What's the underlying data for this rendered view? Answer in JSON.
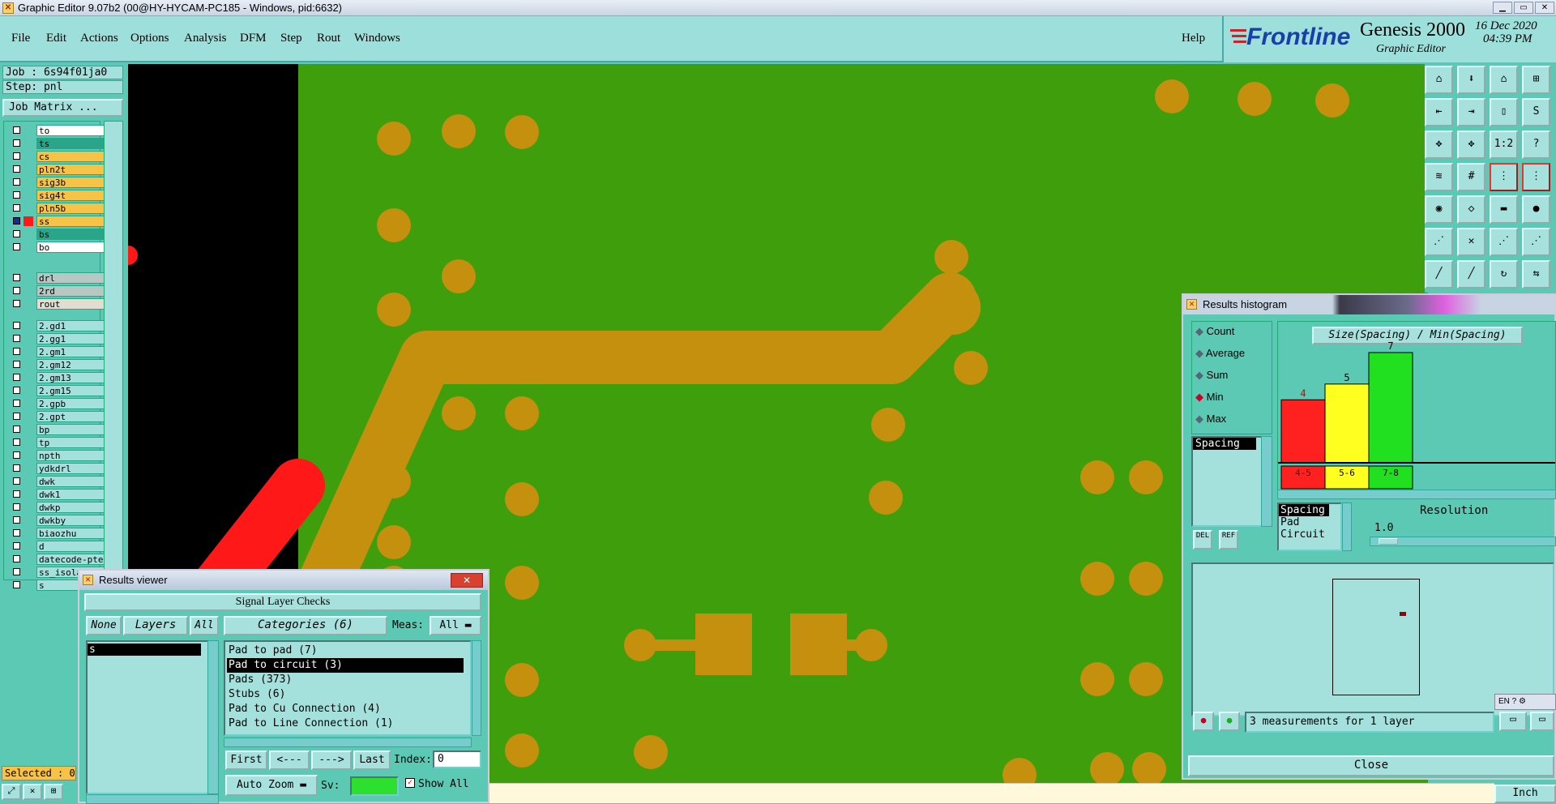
{
  "titlebar": {
    "text": "Graphic Editor 9.07b2 (00@HY-HYCAM-PC185 - Windows, pid:6632)"
  },
  "menu": [
    "File",
    "Edit",
    "Actions",
    "Options",
    "Analysis",
    "DFM",
    "Step",
    "Rout",
    "Windows"
  ],
  "help": "Help",
  "brand": {
    "logo": "Frontline",
    "product": "Genesis 2000",
    "subtitle": "Graphic Editor",
    "date": "16 Dec 2020",
    "time": "04:39 PM"
  },
  "left": {
    "job": "Job : 6s94f01ja0",
    "step": "Step: pnl",
    "job_matrix": "Job Matrix ...",
    "selected": "Selected : 0"
  },
  "layers": {
    "group1": [
      {
        "name": "to",
        "color": "#ffffff"
      },
      {
        "name": "ts",
        "color": "#2aa58a"
      },
      {
        "name": "cs",
        "color": "#f6c346"
      },
      {
        "name": "pln2t",
        "color": "#f6c346"
      },
      {
        "name": "sig3b",
        "color": "#f6c346"
      },
      {
        "name": "sig4t",
        "color": "#f6c346"
      },
      {
        "name": "pln5b",
        "color": "#f6c346"
      },
      {
        "name": "ss",
        "color": "#f6c346"
      },
      {
        "name": "bs",
        "color": "#2aa58a"
      },
      {
        "name": "bo",
        "color": "#ffffff"
      }
    ],
    "group2": [
      {
        "name": "drl",
        "color": "#b7c8c4"
      },
      {
        "name": "2rd",
        "color": "#b7c8c4"
      },
      {
        "name": "rout",
        "color": "#e2ddd0"
      }
    ],
    "group3": [
      "2.gd1",
      "2.gg1",
      "2.gm1",
      "2.gm12",
      "2.gm13",
      "2.gm15",
      "2.gpb",
      "2.gpt",
      "bp",
      "tp",
      "npth",
      "ydkdrl",
      "dwk",
      "dwk1",
      "dwkp",
      "dwkby",
      "biaozhu",
      "d",
      "datecode-pte",
      "ss_isolated",
      "s"
    ]
  },
  "results_viewer": {
    "title": "Results viewer",
    "header": "Signal Layer Checks",
    "none": "None",
    "layers": "Layers",
    "all": "All",
    "categories": "Categories (6)",
    "meas_label": "Meas:",
    "meas_value": "All",
    "layer_list": [
      "s"
    ],
    "category_list": [
      "Pad to pad (7)",
      "Pad to circuit (3)",
      "Pads (373)",
      "Stubs (6)",
      "Pad to Cu Connection (4)",
      "Pad to Line Connection (1)"
    ],
    "selected_category": "Pad to circuit (3)",
    "first": "First",
    "prev": "<---",
    "next": "--->",
    "last": "Last",
    "index_label": "Index:",
    "index_value": "0",
    "auto_zoom": "Auto Zoom",
    "sv_label": "Sv:",
    "show_all": "Show All"
  },
  "histogram": {
    "title": "Results histogram",
    "modes": [
      "Count",
      "Average",
      "Sum",
      "Min",
      "Max"
    ],
    "selected_mode": "Min",
    "chart_title": "Size(Spacing) / Min(Spacing)",
    "list_item": "Spacing",
    "del": "DEL",
    "ref": "REF",
    "attrs": [
      "Spacing",
      "Pad",
      "Circuit"
    ],
    "resolution_label": "Resolution",
    "resolution_value": "1.0",
    "status": "3 measurements for 1 layer",
    "close": "Close",
    "lang": "EN"
  },
  "chart_data": {
    "type": "bar",
    "categories": [
      "4-5",
      "5-6",
      "7-8"
    ],
    "values": [
      4,
      5,
      7
    ],
    "title": "Size(Spacing) / Min(Spacing)",
    "colors": [
      "#ff2020",
      "#ffff20",
      "#20e020"
    ]
  },
  "units": "Inch"
}
